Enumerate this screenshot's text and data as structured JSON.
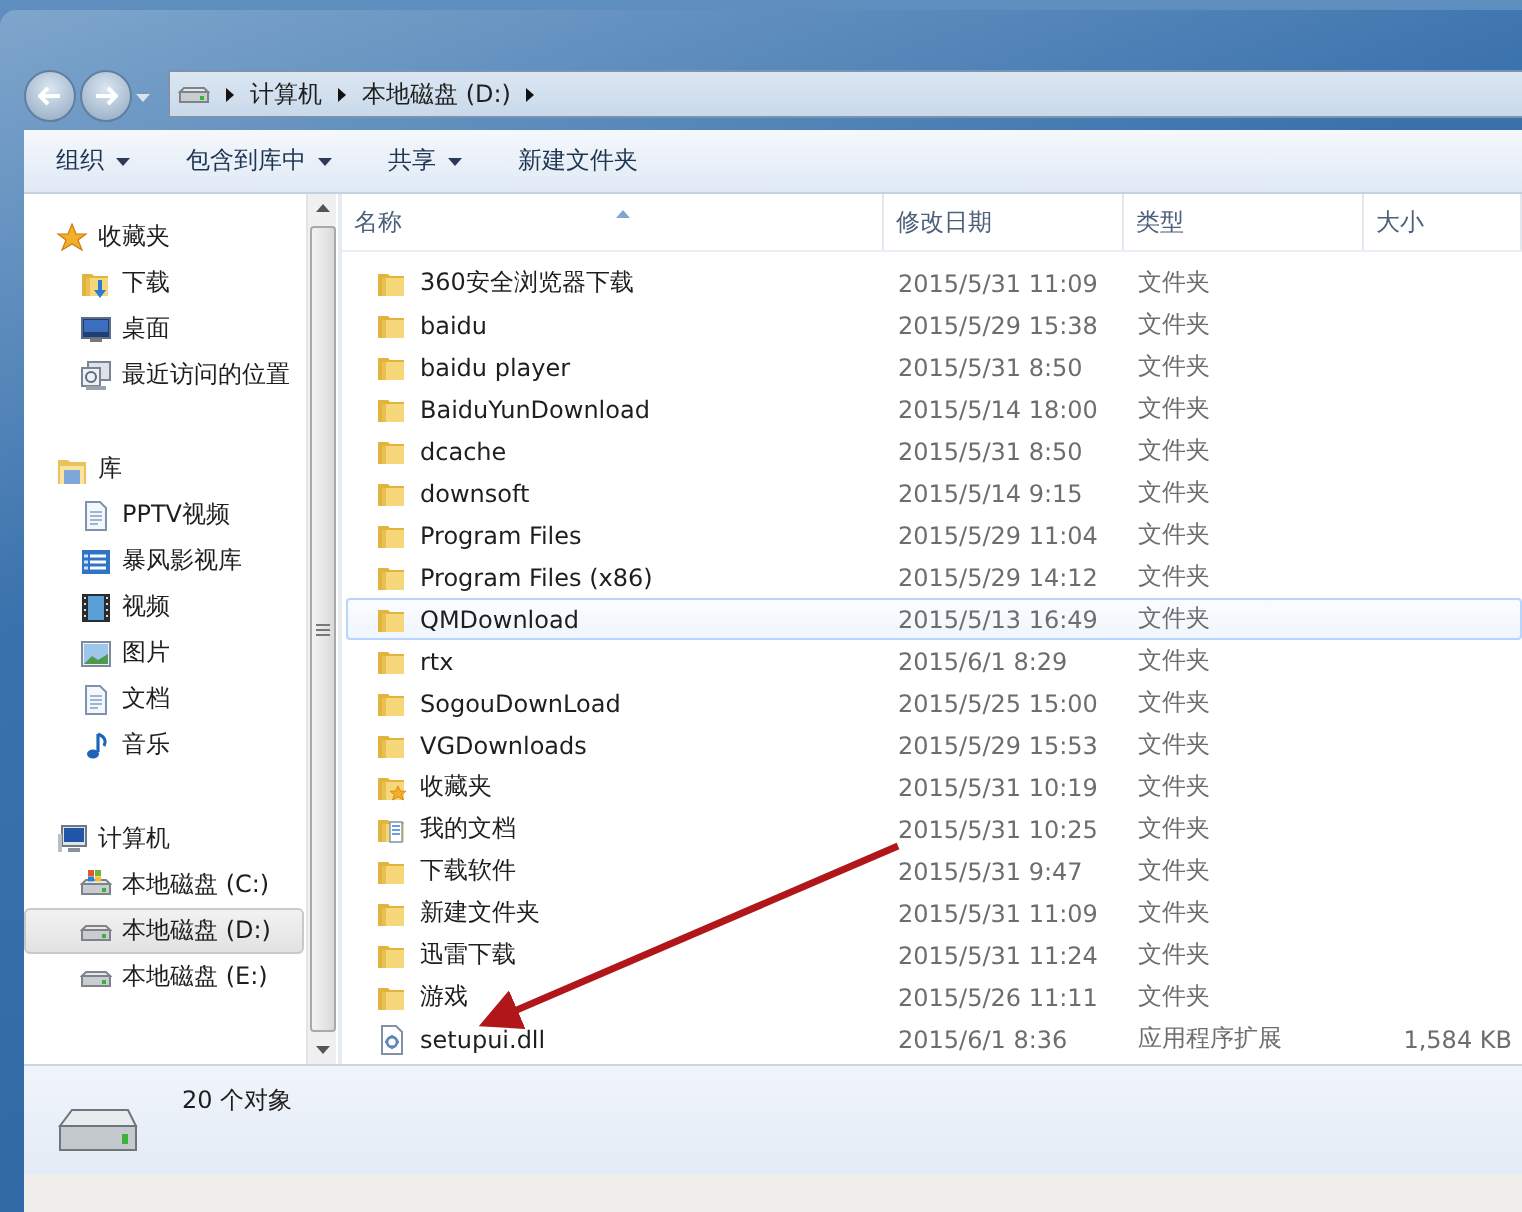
{
  "navigation": {
    "breadcrumb": [
      {
        "label": "计算机"
      },
      {
        "label": "本地磁盘 (D:)"
      }
    ]
  },
  "toolbar": [
    {
      "label": "组织",
      "dropdown": true
    },
    {
      "label": "包含到库中",
      "dropdown": true
    },
    {
      "label": "共享",
      "dropdown": true
    },
    {
      "label": "新建文件夹",
      "dropdown": false
    }
  ],
  "sidebar": {
    "groups": [
      {
        "label": "收藏夹",
        "kind": "favorites",
        "children": [
          {
            "label": "下载",
            "kind": "download",
            "selected": false
          },
          {
            "label": "桌面",
            "kind": "desktop",
            "selected": false
          },
          {
            "label": "最近访问的位置",
            "kind": "recent",
            "selected": false
          }
        ]
      },
      {
        "label": "库",
        "kind": "library",
        "children": [
          {
            "label": "PPTV视频",
            "kind": "doc",
            "selected": false
          },
          {
            "label": "暴风影视库",
            "kind": "list",
            "selected": false
          },
          {
            "label": "视频",
            "kind": "video",
            "selected": false
          },
          {
            "label": "图片",
            "kind": "image",
            "selected": false
          },
          {
            "label": "文档",
            "kind": "doc",
            "selected": false
          },
          {
            "label": "音乐",
            "kind": "music",
            "selected": false
          }
        ]
      },
      {
        "label": "计算机",
        "kind": "computer",
        "children": [
          {
            "label": "本地磁盘 (C:)",
            "kind": "sysdrive",
            "selected": false
          },
          {
            "label": "本地磁盘 (D:)",
            "kind": "drive",
            "selected": true
          },
          {
            "label": "本地磁盘 (E:)",
            "kind": "drive",
            "selected": false
          }
        ]
      }
    ]
  },
  "file_list": {
    "columns": [
      "名称",
      "修改日期",
      "类型",
      "大小"
    ],
    "rows": [
      {
        "name": "360安全浏览器下载",
        "modified": "2015/5/31 11:09",
        "type": "文件夹",
        "kind": "folder",
        "hovered": false
      },
      {
        "name": "baidu",
        "modified": "2015/5/29 15:38",
        "type": "文件夹",
        "kind": "folder",
        "hovered": false
      },
      {
        "name": "baidu player",
        "modified": "2015/5/31 8:50",
        "type": "文件夹",
        "kind": "folder",
        "hovered": false
      },
      {
        "name": "BaiduYunDownload",
        "modified": "2015/5/14 18:00",
        "type": "文件夹",
        "kind": "folder",
        "hovered": false
      },
      {
        "name": "dcache",
        "modified": "2015/5/31 8:50",
        "type": "文件夹",
        "kind": "folder",
        "hovered": false
      },
      {
        "name": "downsoft",
        "modified": "2015/5/14 9:15",
        "type": "文件夹",
        "kind": "folder",
        "hovered": false
      },
      {
        "name": "Program Files",
        "modified": "2015/5/29 11:04",
        "type": "文件夹",
        "kind": "folder",
        "hovered": false
      },
      {
        "name": "Program Files (x86)",
        "modified": "2015/5/29 14:12",
        "type": "文件夹",
        "kind": "folder",
        "hovered": false
      },
      {
        "name": "QMDownload",
        "modified": "2015/5/13 16:49",
        "type": "文件夹",
        "kind": "folder",
        "hovered": true
      },
      {
        "name": "rtx",
        "modified": "2015/6/1 8:29",
        "type": "文件夹",
        "kind": "folder",
        "hovered": false
      },
      {
        "name": "SogouDownLoad",
        "modified": "2015/5/25 15:00",
        "type": "文件夹",
        "kind": "folder",
        "hovered": false
      },
      {
        "name": "VGDownloads",
        "modified": "2015/5/29 15:53",
        "type": "文件夹",
        "kind": "folder",
        "hovered": false
      },
      {
        "name": "收藏夹",
        "modified": "2015/5/31 10:19",
        "type": "文件夹",
        "kind": "favorites",
        "hovered": false
      },
      {
        "name": "我的文档",
        "modified": "2015/5/31 10:25",
        "type": "文件夹",
        "kind": "documents",
        "hovered": false
      },
      {
        "name": "下载软件",
        "modified": "2015/5/31 9:47",
        "type": "文件夹",
        "kind": "folder",
        "hovered": false
      },
      {
        "name": "新建文件夹",
        "modified": "2015/5/31 11:09",
        "type": "文件夹",
        "kind": "folder",
        "hovered": false
      },
      {
        "name": "迅雷下载",
        "modified": "2015/5/31 11:24",
        "type": "文件夹",
        "kind": "folder",
        "hovered": false
      },
      {
        "name": "游戏",
        "modified": "2015/5/26 11:11",
        "type": "文件夹",
        "kind": "folder",
        "hovered": false
      },
      {
        "name": "setupui.dll",
        "modified": "2015/6/1 8:36",
        "type": "应用程序扩展",
        "size": "1,584 KB",
        "kind": "file",
        "hovered": false
      }
    ]
  },
  "status_bar": {
    "count": "20 个对象"
  }
}
